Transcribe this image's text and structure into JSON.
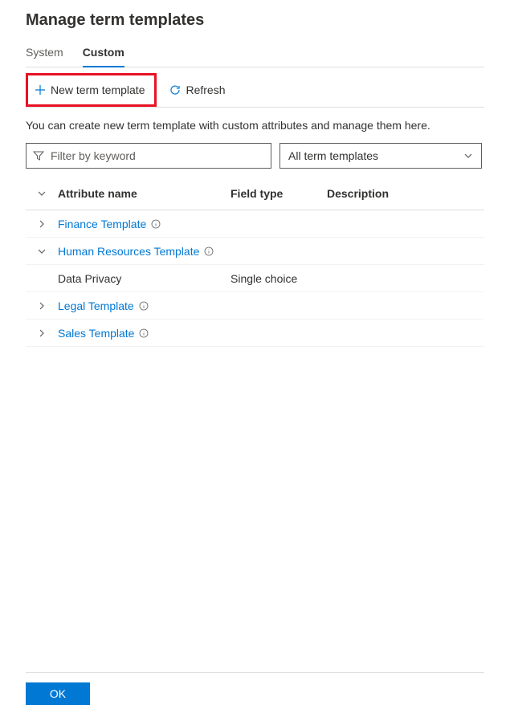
{
  "title": "Manage term templates",
  "tabs": {
    "system": "System",
    "custom": "Custom"
  },
  "toolbar": {
    "new_template": "New term template",
    "refresh": "Refresh"
  },
  "description": "You can create new term template with custom attributes and manage them here.",
  "filter": {
    "placeholder": "Filter by keyword"
  },
  "dropdown": {
    "selected": "All term templates"
  },
  "columns": {
    "name": "Attribute name",
    "field": "Field type",
    "desc": "Description"
  },
  "rows": [
    {
      "type": "template",
      "name": "Finance Template",
      "expanded": false
    },
    {
      "type": "template",
      "name": "Human Resources Template",
      "expanded": true
    },
    {
      "type": "attribute",
      "name": "Data Privacy",
      "field": "Single choice"
    },
    {
      "type": "template",
      "name": "Legal Template",
      "expanded": false
    },
    {
      "type": "template",
      "name": "Sales Template",
      "expanded": false
    }
  ],
  "footer": {
    "ok": "OK"
  }
}
